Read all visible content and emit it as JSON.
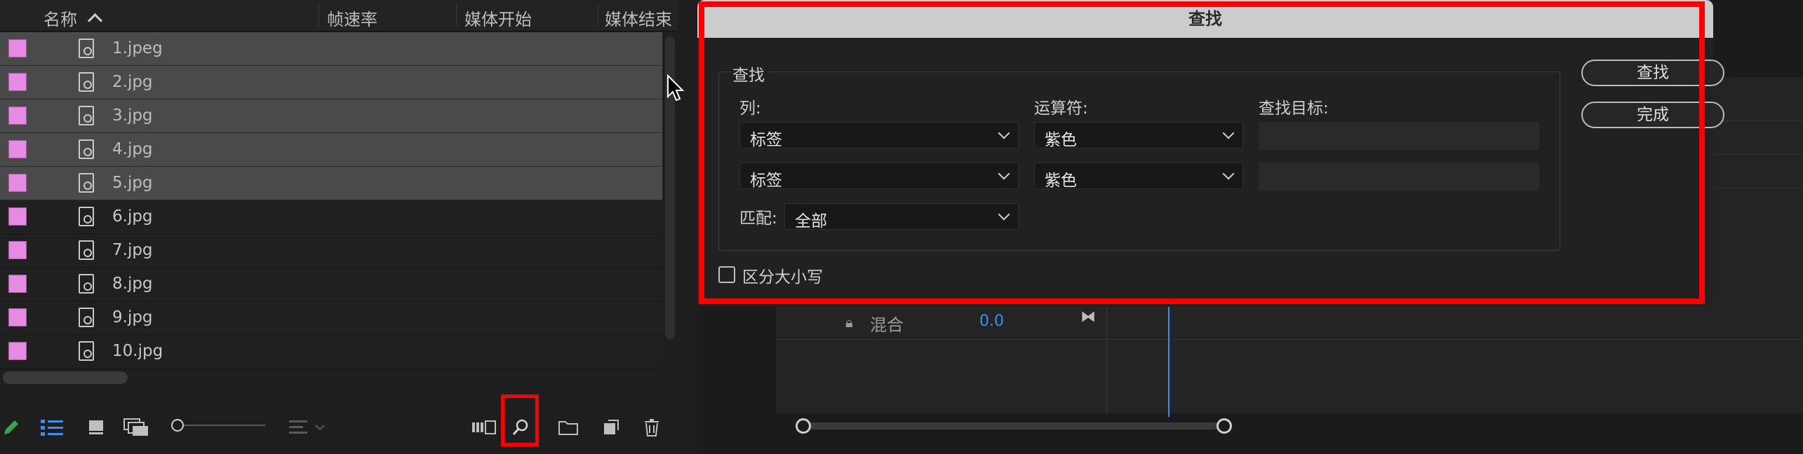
{
  "project_panel": {
    "columns": {
      "name": "名称",
      "frame_rate": "帧速率",
      "media_start": "媒体开始",
      "media_end": "媒体结束"
    },
    "label_color": "#e58be4",
    "items": [
      {
        "name": "1.jpeg",
        "selected": true
      },
      {
        "name": "2.jpg",
        "selected": true
      },
      {
        "name": "3.jpg",
        "selected": true
      },
      {
        "name": "4.jpg",
        "selected": true
      },
      {
        "name": "5.jpg",
        "selected": true
      },
      {
        "name": "6.jpg",
        "selected": false
      },
      {
        "name": "7.jpg",
        "selected": false
      },
      {
        "name": "8.jpg",
        "selected": false
      },
      {
        "name": "9.jpg",
        "selected": false
      },
      {
        "name": "10.jpg",
        "selected": false
      }
    ],
    "toolbar_icons": [
      "pencil-icon",
      "list-view-icon",
      "icon-view-icon",
      "freeform-view-icon",
      "zoom-slider",
      "sort-icon",
      "automate-icon",
      "find-icon",
      "new-bin-icon",
      "new-item-icon",
      "trash-icon"
    ]
  },
  "timeline": {
    "blend_label": "混合",
    "blend_value": "0.0",
    "playhead_color": "#3a8df5"
  },
  "find_dialog": {
    "title": "查找",
    "group_label": "查找",
    "column_label": "列:",
    "operator_label": "运算符:",
    "target_label": "查找目标:",
    "rows": [
      {
        "column": "标签",
        "operator": "紫色",
        "target": ""
      },
      {
        "column": "标签",
        "operator": "紫色",
        "target": ""
      }
    ],
    "match_label": "匹配:",
    "match_value": "全部",
    "case_sensitive_label": "区分大小写",
    "case_sensitive_checked": false,
    "find_button": "查找",
    "done_button": "完成"
  },
  "highlight_color": "#ff0000"
}
